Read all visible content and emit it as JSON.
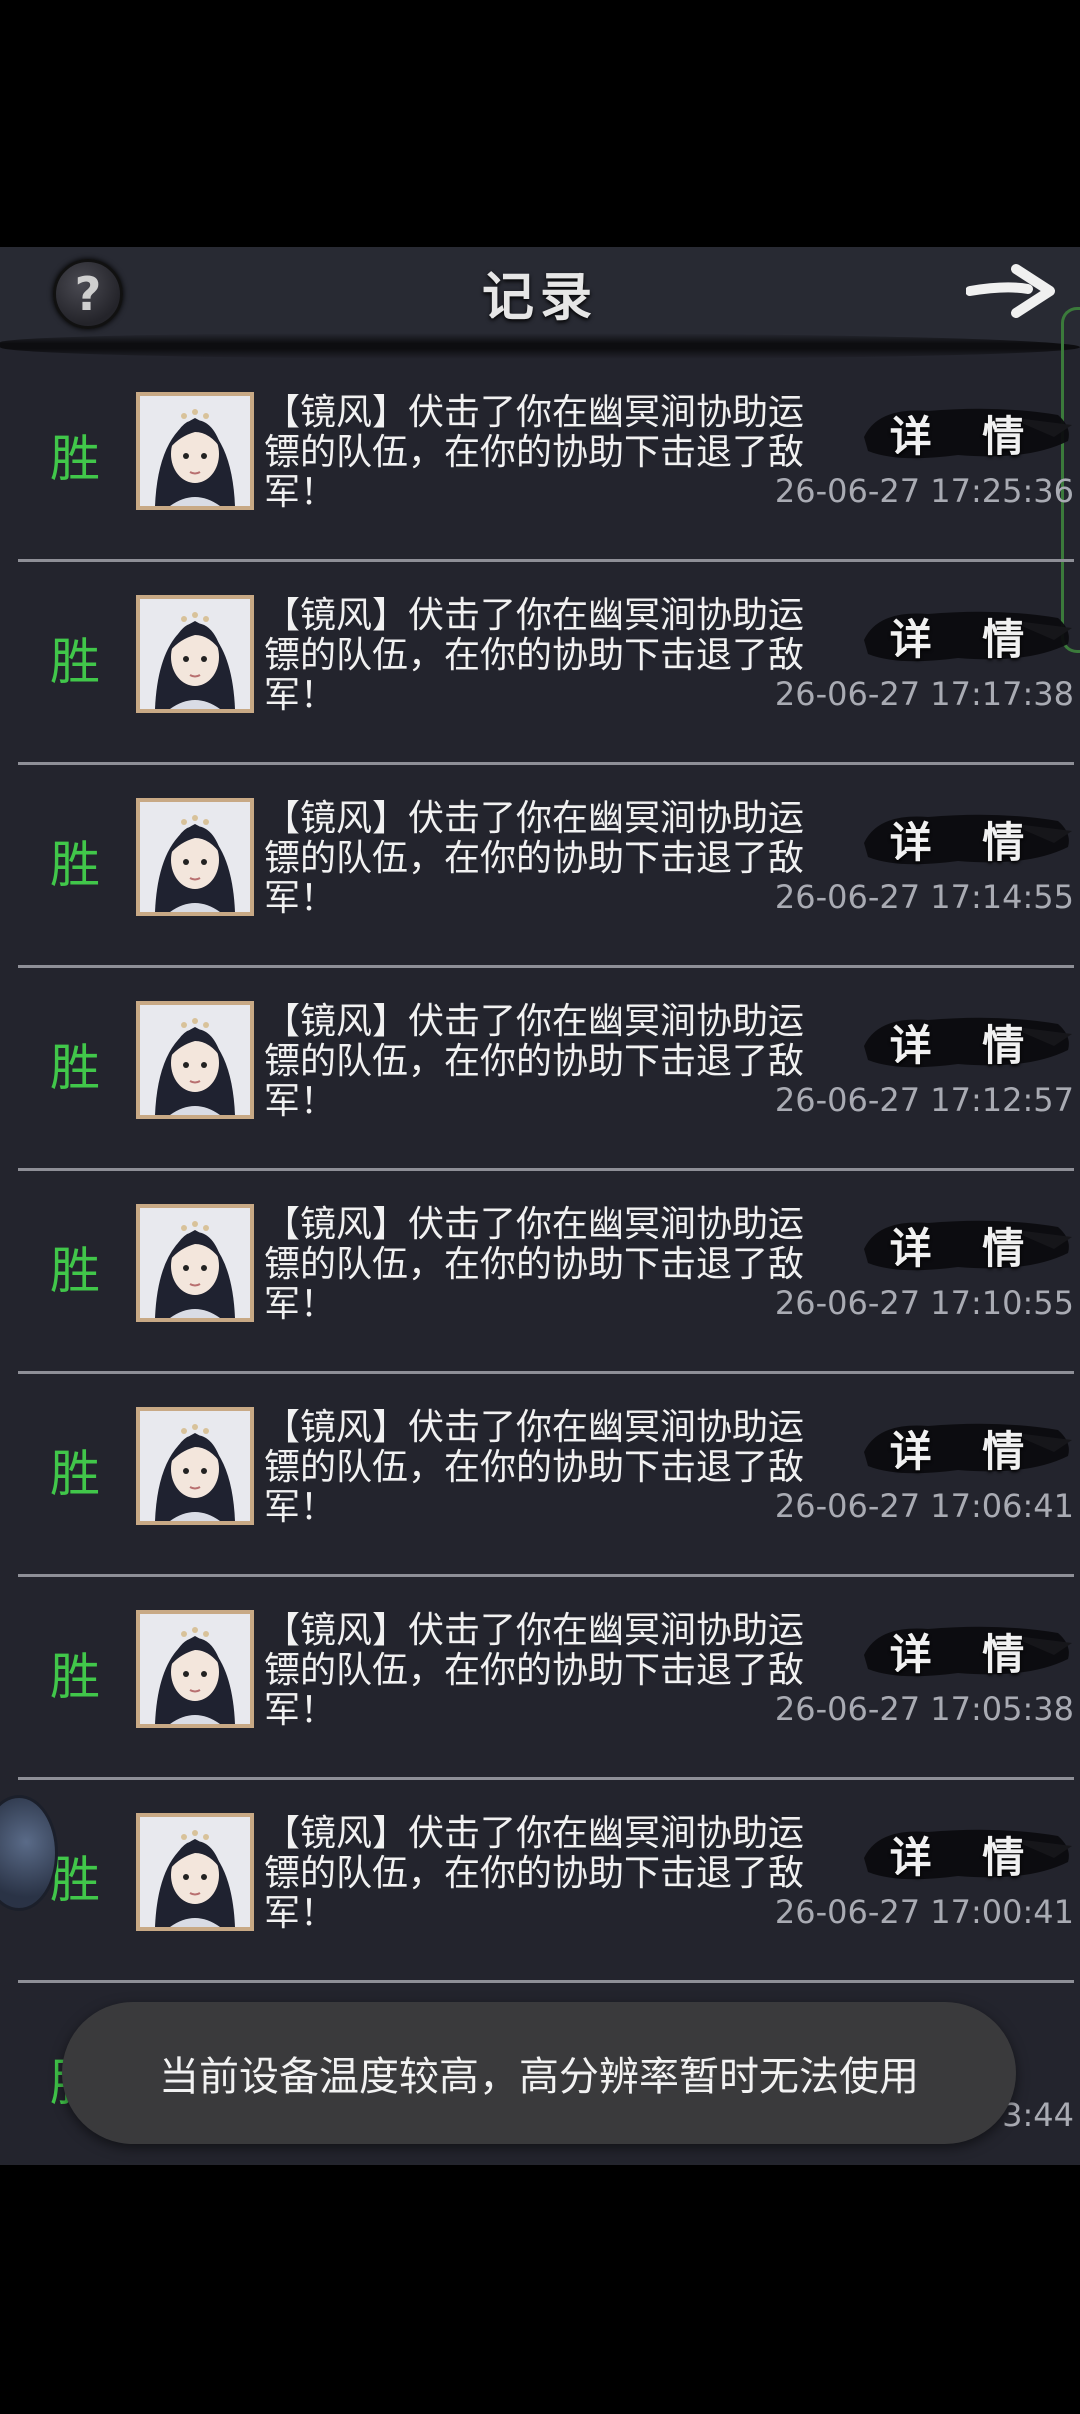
{
  "header": {
    "title": "记录",
    "help_icon": "question-mark-icon",
    "next_icon": "arrow-right-icon"
  },
  "records": [
    {
      "result": "胜",
      "message": "【镜风】伏击了你在幽冥涧协助运镖的队伍，在你的协助下击退了敌军！",
      "detail_label": "详 情",
      "time": "26-06-27 17:25:36"
    },
    {
      "result": "胜",
      "message": "【镜风】伏击了你在幽冥涧协助运镖的队伍，在你的协助下击退了敌军！",
      "detail_label": "详 情",
      "time": "26-06-27 17:17:38"
    },
    {
      "result": "胜",
      "message": "【镜风】伏击了你在幽冥涧协助运镖的队伍，在你的协助下击退了敌军！",
      "detail_label": "详 情",
      "time": "26-06-27 17:14:55"
    },
    {
      "result": "胜",
      "message": "【镜风】伏击了你在幽冥涧协助运镖的队伍，在你的协助下击退了敌军！",
      "detail_label": "详 情",
      "time": "26-06-27 17:12:57"
    },
    {
      "result": "胜",
      "message": "【镜风】伏击了你在幽冥涧协助运镖的队伍，在你的协助下击退了敌军！",
      "detail_label": "详 情",
      "time": "26-06-27 17:10:55"
    },
    {
      "result": "胜",
      "message": "【镜风】伏击了你在幽冥涧协助运镖的队伍，在你的协助下击退了敌军！",
      "detail_label": "详 情",
      "time": "26-06-27 17:06:41"
    },
    {
      "result": "胜",
      "message": "【镜风】伏击了你在幽冥涧协助运镖的队伍，在你的协助下击退了敌军！",
      "detail_label": "详 情",
      "time": "26-06-27 17:05:38"
    },
    {
      "result": "胜",
      "message": "【镜风】伏击了你在幽冥涧协助运镖的队伍，在你的协助下击退了敌军！",
      "detail_label": "详 情",
      "time": "26-06-27 17:00:41"
    },
    {
      "result": "胜",
      "message": "",
      "detail_label": "",
      "time": "3:44"
    }
  ],
  "toast": {
    "text": "当前设备温度较高，高分辨率暂时无法使用"
  },
  "colors": {
    "win": "#41c74a",
    "background": "#23242d",
    "avatar_frame": "#c8a985"
  }
}
